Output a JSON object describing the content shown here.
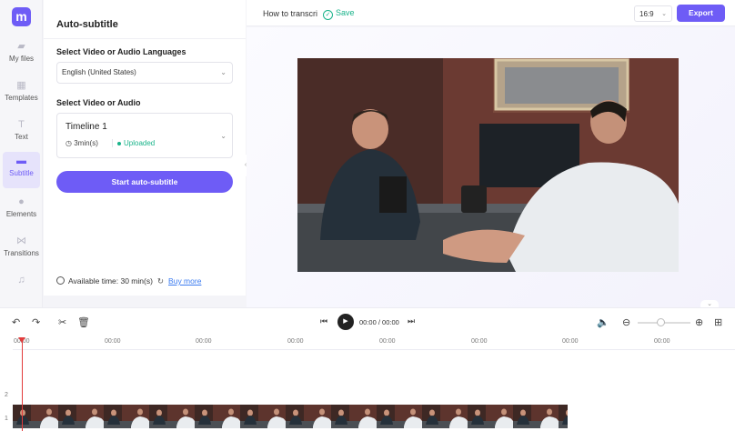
{
  "app": {
    "logo_text": "m"
  },
  "rail": {
    "items": [
      {
        "label": "My files",
        "icon": "folder-icon"
      },
      {
        "label": "Templates",
        "icon": "templates-icon"
      },
      {
        "label": "Text",
        "icon": "text-icon"
      },
      {
        "label": "Subtitle",
        "icon": "subtitle-icon",
        "active": true
      },
      {
        "label": "Elements",
        "icon": "elements-icon"
      },
      {
        "label": "Transitions",
        "icon": "transitions-icon"
      },
      {
        "label": "",
        "icon": "music-icon"
      }
    ]
  },
  "panel": {
    "title": "Auto-subtitle",
    "language_label": "Select Video or Audio Languages",
    "language_value": "English (United States)",
    "source_label": "Select Video or Audio",
    "source_name": "Timeline 1",
    "source_duration": "3min(s)",
    "source_status": "Uploaded",
    "start_button": "Start auto-subtitle",
    "available_time": "Available time: 30 min(s)",
    "buy_more": "Buy more"
  },
  "topbar": {
    "project_name": "How to transcri",
    "save_label": "Save",
    "aspect_ratio": "16:9",
    "export_label": "Export"
  },
  "timeline": {
    "current_time": "00:00 / 00:00",
    "ruler_labels": [
      "00:00",
      "00:00",
      "00:00",
      "00:00",
      "00:00",
      "00:00",
      "00:00",
      "00:00"
    ],
    "tracks": [
      "2",
      "1"
    ]
  },
  "colors": {
    "accent": "#6e5cf6",
    "success": "#19b38a",
    "playhead": "#e23b3b",
    "link": "#3b7bf0"
  }
}
